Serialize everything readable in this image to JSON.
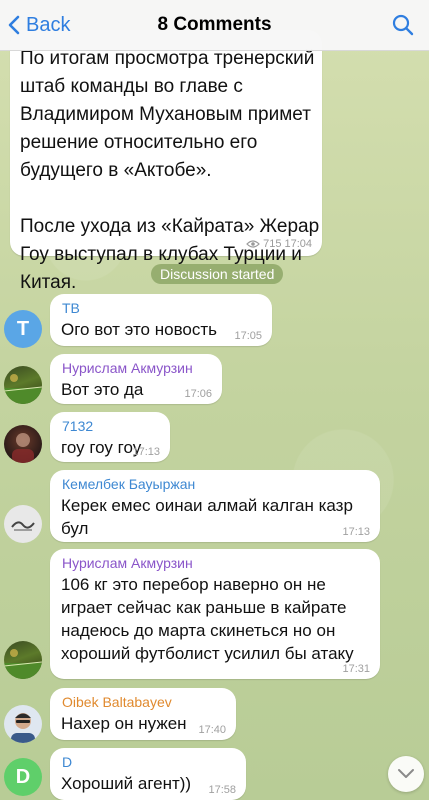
{
  "header": {
    "back_label": "Back",
    "title": "8 Comments"
  },
  "post": {
    "text": "По итогам просмотра тренерский\nштаб команды во главе с\nВладимиром Мухановым примет\nрешение относительно его\nбудущего в «Актобе».\n\nПосле ухода из «Кайрата» Жерар\nГоу выступал в клубах Турции и\nКитая.",
    "views": "715",
    "time": "17:04"
  },
  "divider": "Discussion started",
  "comments": [
    {
      "author": "ТВ",
      "avatar_letter": "T",
      "avatar_color": "#5aa6e6",
      "name_color": "#3e88d2",
      "text": "Ого вот это новость",
      "time": "17:05"
    },
    {
      "author": "Нурислам Акмурзин",
      "name_color": "#8a55c9",
      "text": "Вот это да",
      "time": "17:06"
    },
    {
      "author": "7132",
      "name_color": "#3e88d2",
      "text": "гоу гоу гоу",
      "time": "17:13"
    },
    {
      "author": "Кемелбек Бауыржан",
      "name_color": "#3e88d2",
      "text_lines": [
        "Керек емес оинаи алмай калган казр",
        "бул"
      ],
      "time": "17:13"
    },
    {
      "author": "Нурислам Акмурзин",
      "name_color": "#8a55c9",
      "text_lines": [
        "106 кг это перебор наверно он не",
        "играет сейчас как раньше в кайрате",
        "надеюсь до марта скинеться но он",
        "хороший футболист усилил бы атаку"
      ],
      "time": "17:31"
    },
    {
      "author": "Oibek Baltabayev",
      "name_color": "#e08a2f",
      "text": "Нахер он нужен",
      "time": "17:40"
    },
    {
      "author": "D",
      "avatar_letter": "D",
      "avatar_color": "#5fcf6a",
      "name_color": "#3e88d2",
      "text": "Хороший агент))",
      "time": "17:58"
    }
  ]
}
